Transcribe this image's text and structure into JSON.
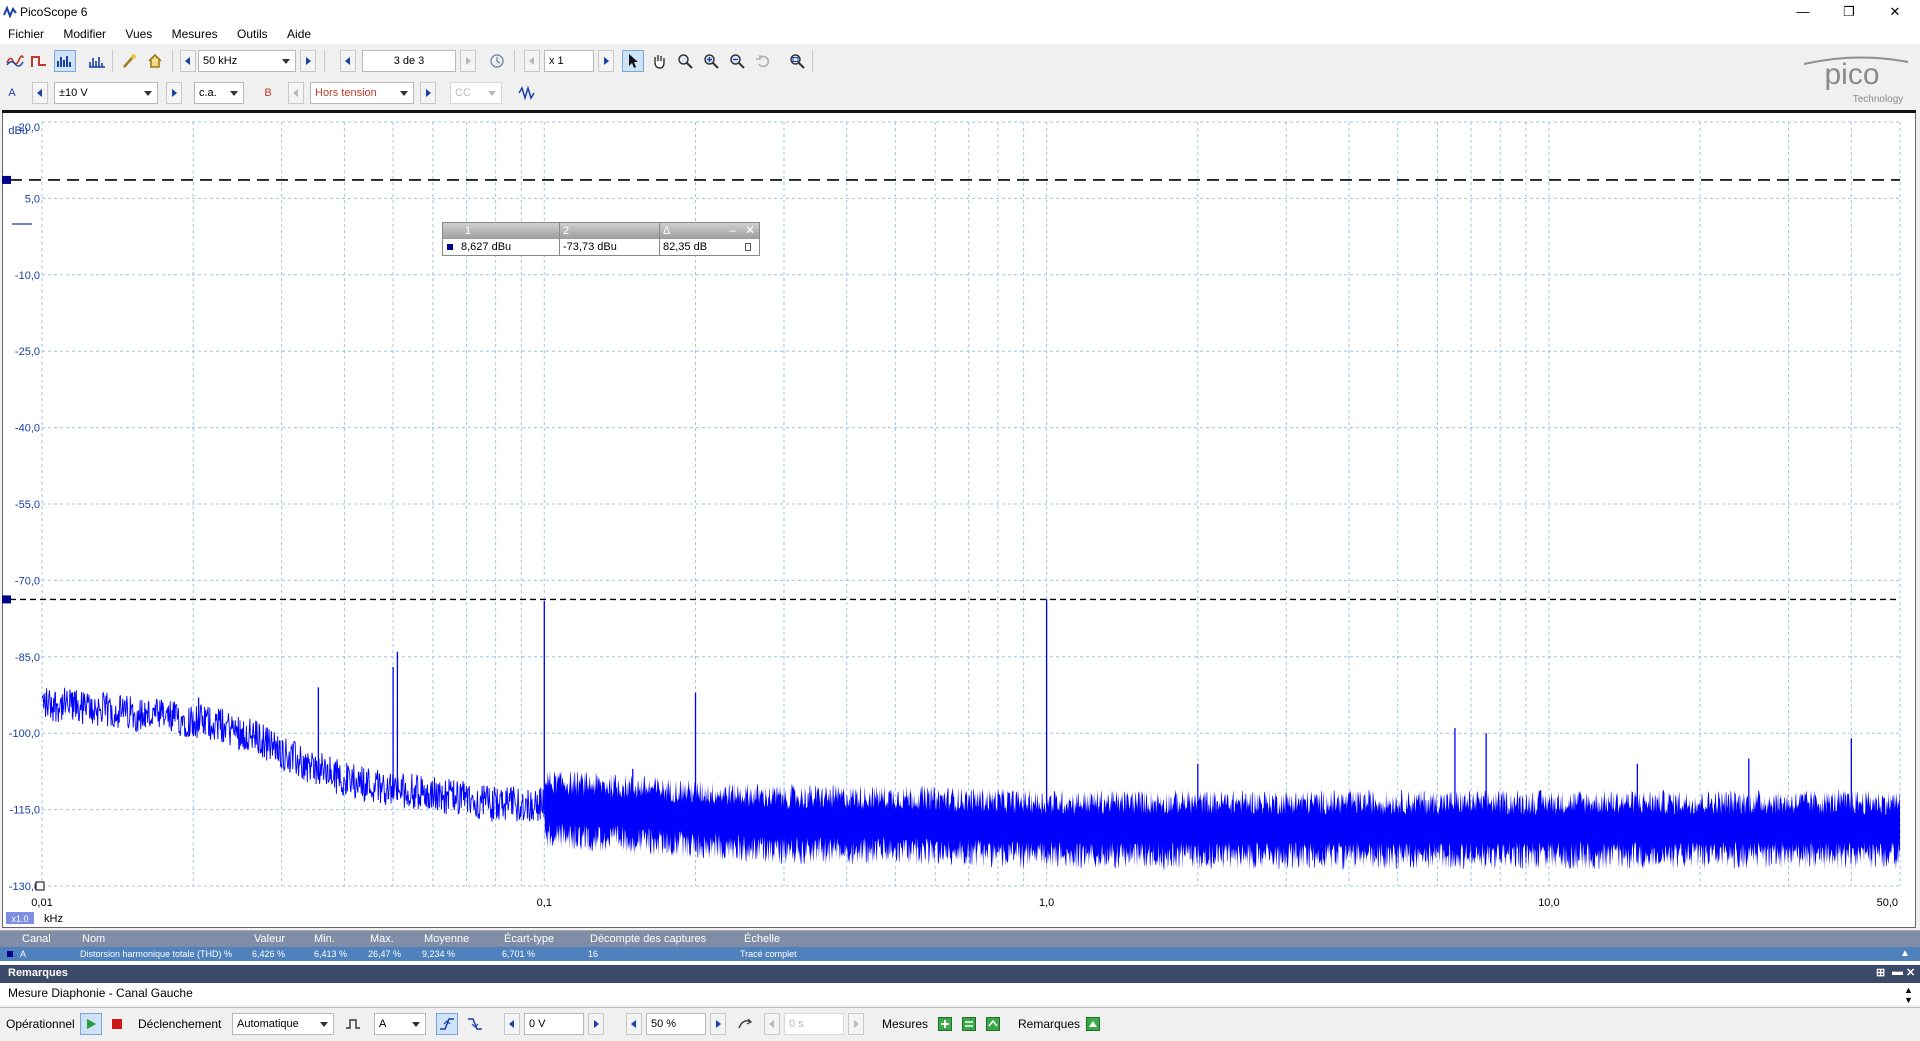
{
  "window": {
    "title": "PicoScope 6",
    "minimize": "—",
    "restore": "❐",
    "close": "✕"
  },
  "menu": [
    "Fichier",
    "Modifier",
    "Vues",
    "Mesures",
    "Outils",
    "Aide"
  ],
  "toolbar": {
    "bandwidth": "50 kHz",
    "capture": "3 de 3",
    "zoom": "x 1"
  },
  "channels": {
    "a_label": "A",
    "a_range": "±10 V",
    "a_coupling": "c.a.",
    "b_label": "B",
    "b_range": "Hors tension",
    "b_coupling": "CC"
  },
  "logo": {
    "text": "pico",
    "sub": "Technology"
  },
  "plot": {
    "y_unit": "dBu",
    "x_unit": "kHz",
    "x_scale_badge": "x1.0",
    "y_ticks": [
      "20,0",
      "5,0",
      "-10,0",
      "-25,0",
      "-40,0",
      "-55,0",
      "-70,0",
      "-85,0",
      "-100,0",
      "-115,0",
      "-130,0"
    ],
    "x_ticks": [
      "0,01",
      "0,1",
      "1,0",
      "10,0",
      "50,0"
    ],
    "colors": {
      "trace": "#0000ff",
      "grid": "#9ec5e6",
      "axis_text": "#1a3fa6"
    }
  },
  "chart_data": {
    "type": "line",
    "title": "",
    "xlabel": "kHz",
    "ylabel": "dBu",
    "x_scale": "log",
    "xlim": [
      0.01,
      50
    ],
    "ylim": [
      -130,
      20
    ],
    "grid": true,
    "series": [
      {
        "x": [
          0.01,
          0.012,
          0.015,
          0.018,
          0.022,
          0.027,
          0.033,
          0.04,
          0.05,
          0.06,
          0.07,
          0.08,
          0.1,
          0.15,
          0.2,
          0.3,
          0.5,
          1.0,
          2.0,
          5.0,
          10.0,
          20.0,
          30.0,
          50.0
        ],
        "y": [
          -94,
          -95,
          -96,
          -97,
          -98,
          -101,
          -106,
          -109,
          -111,
          -112,
          -113,
          -114,
          -114,
          -115,
          -116,
          -117,
          -117,
          -118,
          -118,
          -118,
          -118,
          -118,
          -118,
          -118
        ]
      }
    ],
    "peaks": [
      {
        "x": 0.0115,
        "y": -92
      },
      {
        "x": 0.0205,
        "y": -93
      },
      {
        "x": 0.0355,
        "y": -91
      },
      {
        "x": 0.05,
        "y": -87
      },
      {
        "x": 0.051,
        "y": -84
      },
      {
        "x": 0.1,
        "y": -74
      },
      {
        "x": 0.15,
        "y": -107
      },
      {
        "x": 0.2,
        "y": -92
      },
      {
        "x": 1.0,
        "y": -73.7
      },
      {
        "x": 2.0,
        "y": -106
      },
      {
        "x": 6.5,
        "y": -99
      },
      {
        "x": 7.5,
        "y": -100
      },
      {
        "x": 15.0,
        "y": -106
      },
      {
        "x": 25.0,
        "y": -105
      },
      {
        "x": 40.0,
        "y": -101
      }
    ],
    "rulers": [
      {
        "name": "1",
        "value_dbu": 8.627
      },
      {
        "name": "2",
        "value_dbu": -73.73
      }
    ]
  },
  "ruler_table": {
    "headers": [
      "1",
      "2",
      "Δ"
    ],
    "values": [
      "8,627 dBu",
      "-73,73 dBu",
      "82,35 dB"
    ]
  },
  "measurements": {
    "headers": [
      "Canal",
      "Nom",
      "Valeur",
      "Min.",
      "Max.",
      "Moyenne",
      "Écart-type",
      "Décompte des captures",
      "Échelle"
    ],
    "row": [
      "A",
      "Distorsion harmonique totale (THD) %",
      "6,426 %",
      "6,413 %",
      "26,47 %",
      "9,234 %",
      "6,701 %",
      "16",
      "Tracé complet"
    ]
  },
  "remarks": {
    "title": "Remarques",
    "text": "Mesure Diaphonie - Canal Gauche"
  },
  "statusbar": {
    "state": "Opérationnel",
    "trigger_label": "Déclenchement",
    "trigger_mode": "Automatique",
    "trigger_source": "A",
    "trigger_level": "0 V",
    "pretrigger": "50 %",
    "delay": "0 s",
    "measures_label": "Mesures",
    "remarks_label": "Remarques"
  }
}
